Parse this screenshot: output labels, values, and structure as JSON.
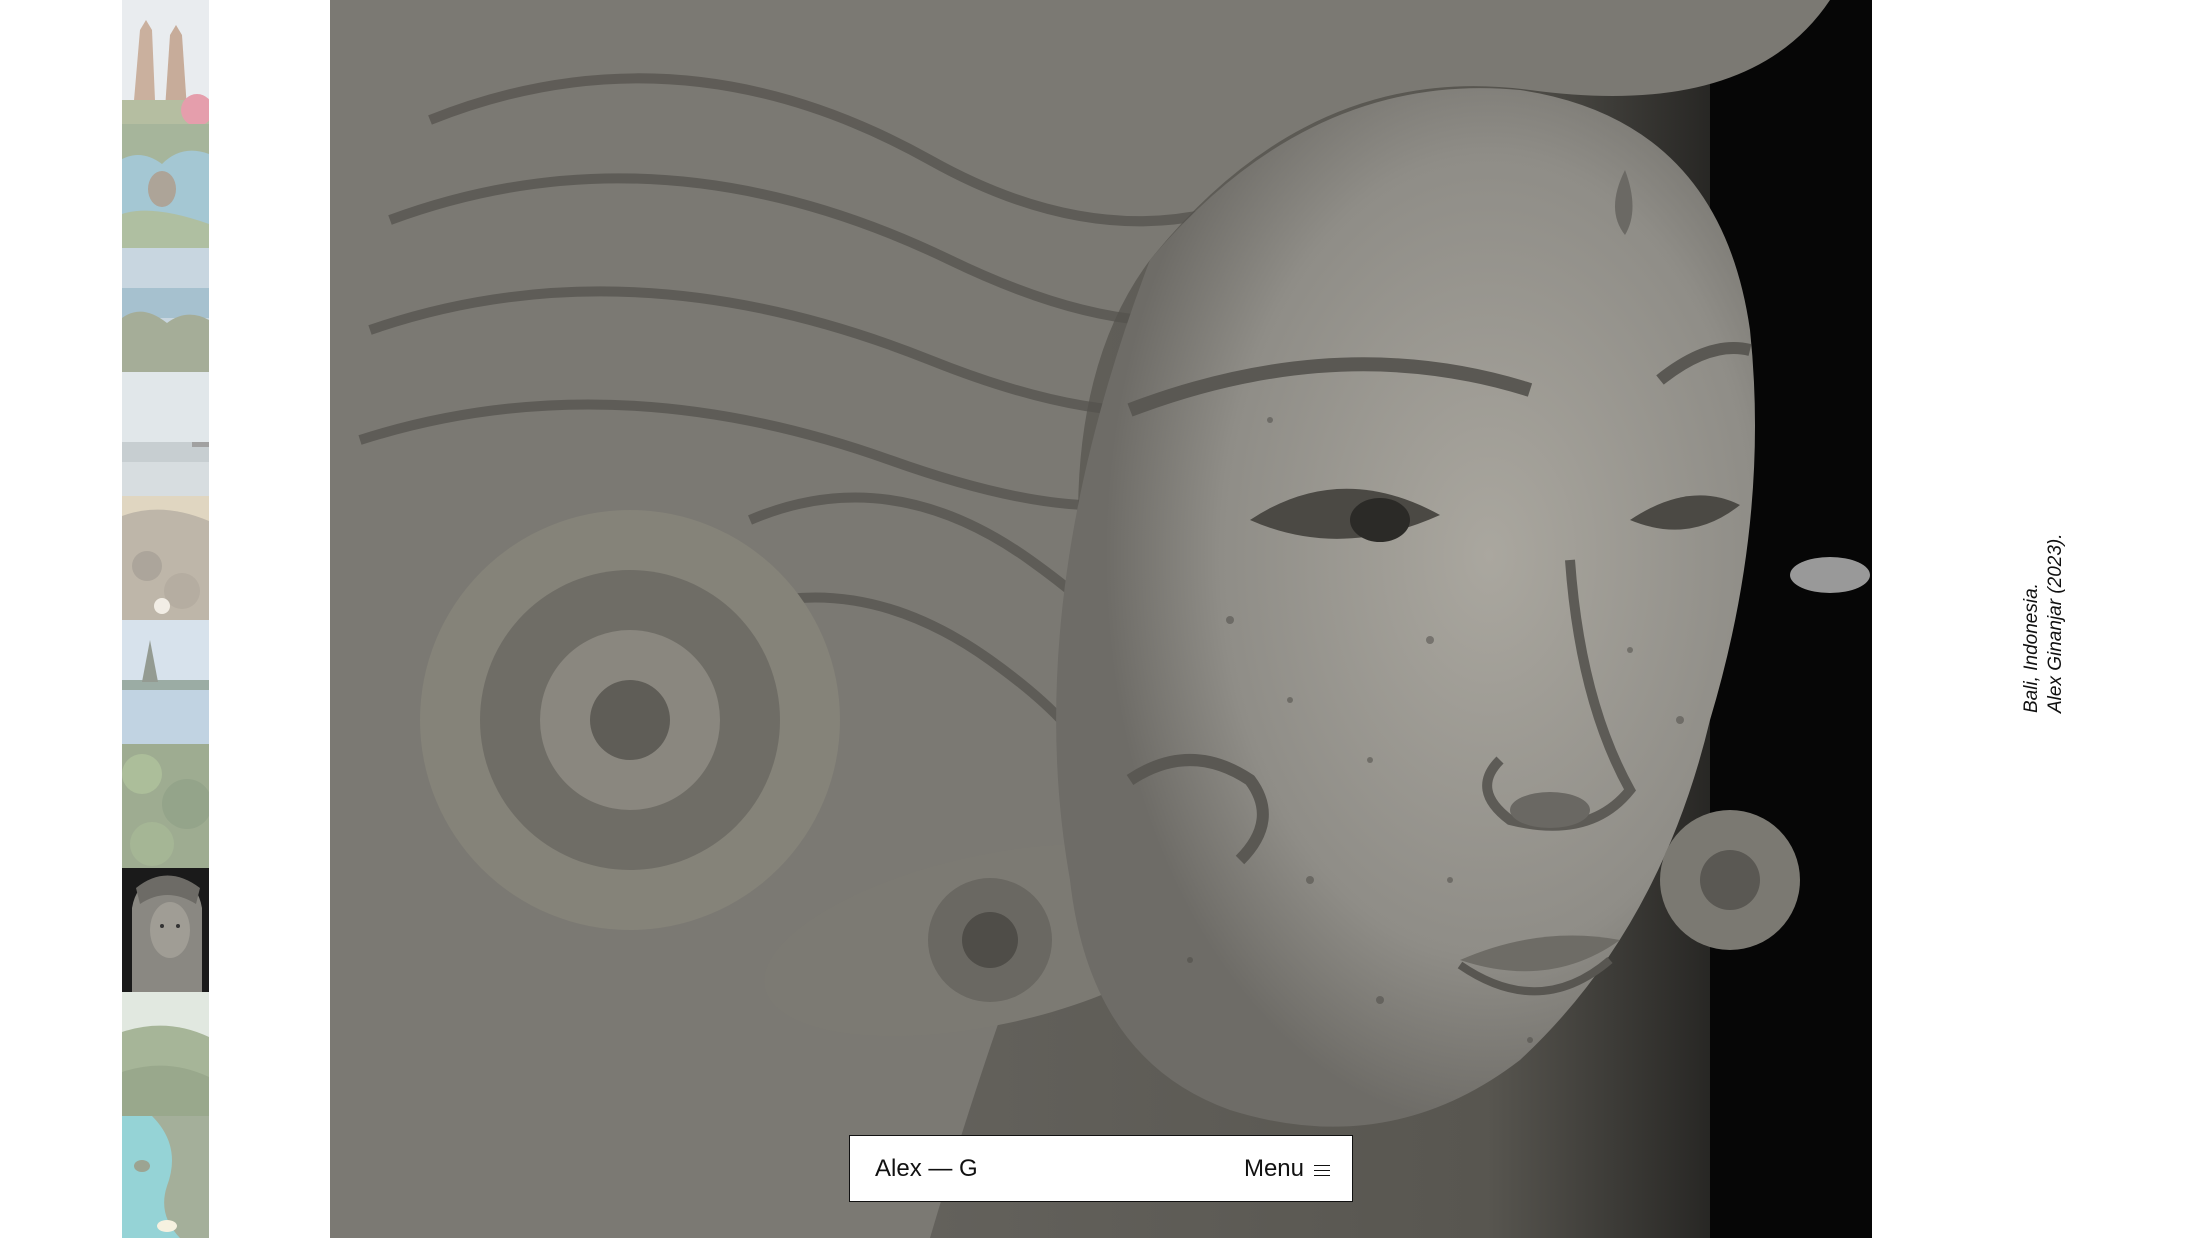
{
  "gallery": {
    "thumbnails": [
      {
        "name": "temple-gates",
        "active": false
      },
      {
        "name": "ocean-cliffs",
        "active": false
      },
      {
        "name": "coastal-rocks",
        "active": false
      },
      {
        "name": "sea-horizon",
        "active": false
      },
      {
        "name": "beach-rocks",
        "active": false
      },
      {
        "name": "lake-temple",
        "active": false
      },
      {
        "name": "jungle",
        "active": false
      },
      {
        "name": "stone-statue",
        "active": true
      },
      {
        "name": "forest-valley",
        "active": false
      },
      {
        "name": "turquoise-lagoon",
        "active": false
      }
    ]
  },
  "caption": {
    "location": "Bali, Indonesia.",
    "credit": "Alex Ginanjar (2023)."
  },
  "navbar": {
    "brand": "Alex — G",
    "menu_label": "Menu"
  },
  "colors": {
    "background": "#ffffff",
    "text": "#111111",
    "stone": "#8f8d87"
  }
}
